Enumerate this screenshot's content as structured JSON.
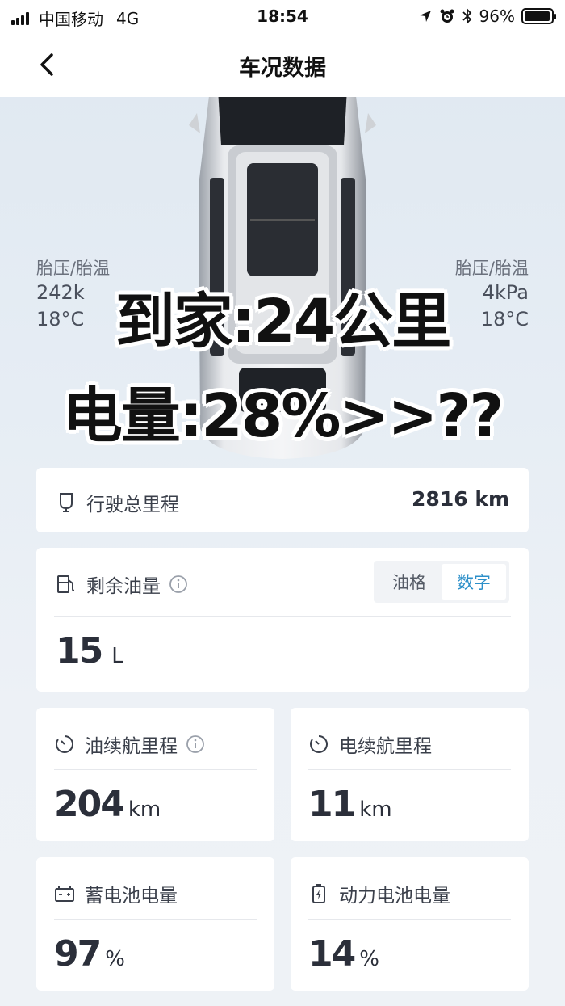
{
  "status_bar": {
    "carrier": "中国移动",
    "network": "4G",
    "time": "18:54",
    "battery": "96%",
    "battery_level": 0.96
  },
  "nav": {
    "title": "车况数据"
  },
  "tires": {
    "left_caption": "胎压/胎温",
    "left_pressure": "242k",
    "left_temp": "18°C",
    "right_caption": "胎压/胎温",
    "right_pressure": "4kPa",
    "right_temp": "18°C"
  },
  "overlay": {
    "line1": "到家:24公里",
    "line2": "电量:28%>>??"
  },
  "odometer": {
    "label": "行驶总里程",
    "value": "2816 km"
  },
  "fuel": {
    "label": "剩余油量",
    "seg_bars": "油格",
    "seg_number": "数字",
    "value": "15",
    "unit": "L"
  },
  "fuel_range": {
    "label": "油续航里程",
    "value": "204",
    "unit": "km"
  },
  "ev_range": {
    "label": "电续航里程",
    "value": "11",
    "unit": "km"
  },
  "battery12v": {
    "label": "蓄电池电量",
    "value": "97",
    "unit": "%"
  },
  "power_battery": {
    "label": "动力电池电量",
    "value": "14",
    "unit": "%"
  },
  "colors": {
    "accent": "#2c8fc9",
    "text": "#2b2f38"
  }
}
